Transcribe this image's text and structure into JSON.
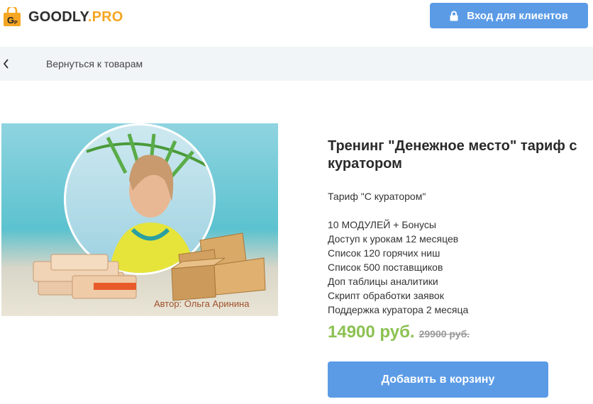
{
  "header": {
    "logo_main": "GOODLY",
    "logo_dot": ".",
    "logo_suffix": "PRO",
    "login_label": "Вход для клиентов"
  },
  "nav": {
    "back_label": "Вернуться к товарам"
  },
  "product": {
    "image_caption": "Автор: Ольга Аринина",
    "title": "Тренинг \"Денежное место\" тариф с куратором",
    "tariff": "Тариф \"С куратором\"",
    "features": [
      "10 МОДУЛЕЙ + Бонусы",
      "Доступ к урокам 12 месяцев",
      "Список 120 горячих ниш",
      "Список 500 поставщиков",
      "Доп таблицы аналитики",
      "Скрипт обработки заявок",
      "Поддержка куратора 2 месяца"
    ],
    "price": "14900 руб.",
    "old_price": "29900 руб.",
    "cart_label": "Добавить в корзину"
  },
  "colors": {
    "accent": "#5b9be6",
    "price": "#8cc152",
    "logo_orange": "#f5a623"
  },
  "icons": {
    "logo": "shopping-bag-icon",
    "login": "lock-icon",
    "back": "chevron-left-icon"
  }
}
